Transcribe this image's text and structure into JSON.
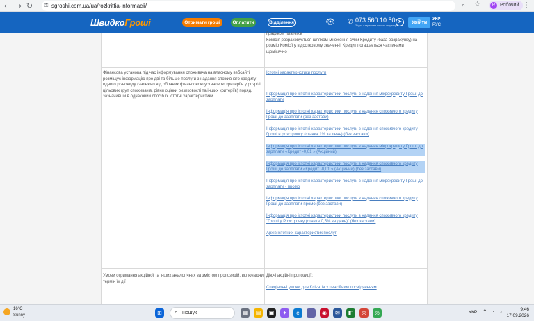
{
  "browser": {
    "url": "sgroshi.com.ua/ua/rozkrittia-informacii/",
    "profile_name": "Робочий",
    "profile_initial": "R",
    "back_icon": "arrow-left-icon",
    "forward_icon": "arrow-right-icon",
    "reload_icon": "reload-icon"
  },
  "header": {
    "logo_part1": "Швидко",
    "logo_part2": "Гроші",
    "btn_get_money": "Отримати гроші",
    "btn_pay": "Оплатити",
    "btn_branches": "Відділення",
    "phone": "073 560 10 50",
    "phone_note": "Згідно з тарифами вашого оператора",
    "btn_login": "Увійти",
    "lang_ukr": "УКР",
    "lang_rus": "РУС",
    "brand_color": "#1565c0",
    "accent_orange": "#f57c00",
    "accent_green": "#43a047"
  },
  "table": {
    "row0_right": "Графіком платежів\nКомісія розраховується шляхом множення суми Кредиту (база розрахунку) на розмір Комісії у відсотковому значенні. Кредит погашається частинами щомісячно",
    "row1_left": "Фінансова установа під час інформування споживача на власному вебсайті розміщує інформацію про дві та більше послуги з надання споживчого кредиту одного різновиду (залежно від обраних фінансовою установою критеріїв у розрізі цільових груп споживачів, рівня оцінки ризиковості та інших критеріїв) поряд, зазначивши в однаковий спосіб їх істотні характеристики",
    "row1_links": [
      "Істотні характеристики послуги",
      "Інформація про істотні характеристики послуги з надання мікрокредиту Гроші до зарплати",
      "Інформація про істотні характеристики послуги з надання споживчого кредиту Гроші до зарплати (без застави)",
      "Інформація про істотні характеристики послуги з надання споживчого кредиту Гроші в розстрочку (ставка 1% за день) (без застави)",
      "Інформація про істотні характеристики послуги з надання мікрокредиту Гроші до зарплати «Кредит -0,01 » (Акційний)",
      "Інформація про істотні характеристики послуги з надання споживчого кредиту Гроші до зарплати «Кредит -0,01 » (Акційний) (без застави)",
      "Інформація про істотні характеристики послуги з надання мікрокредиту Гроші до зарплати - промо",
      "Інформація про істотні характеристики послуги з надання споживчого кредиту Гроші до зарплати-промо (без застави)",
      "Інформація про істотні характеристики послуги з надання споживчого кредиту \"Гроші у Розстрочку (ставка 0,5% за день)\" (без застави)",
      "Архів істотних характеристик послуг"
    ],
    "row2_left": "Умови отримання акційної та інших аналогічних за змістом пропозицій, включаючи термін їх дії",
    "row2_right_text": "Діючі акційні пропозиції:",
    "row2_right_link": "Спеціальні умови для Клієнтів з пенсійним посвідченням"
  },
  "taskbar": {
    "weather_temp": "16°C",
    "weather_desc": "Sunny",
    "search_placeholder": "Пошук",
    "lang": "УКР",
    "time": "9:46",
    "date": "17.09.2026"
  }
}
